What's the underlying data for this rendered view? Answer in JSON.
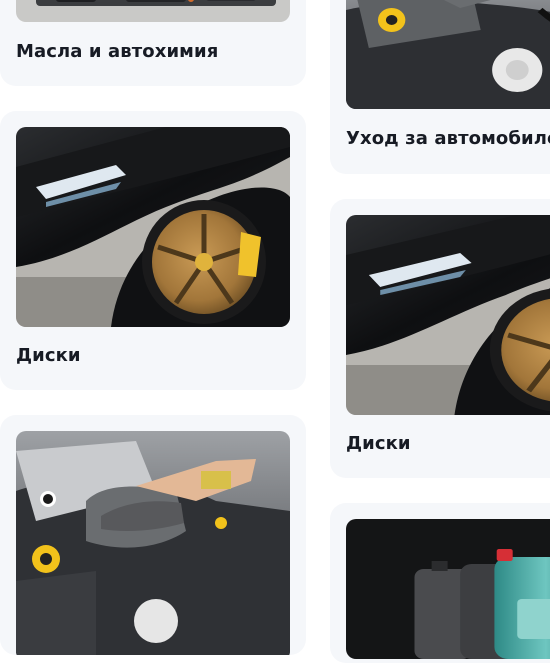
{
  "categories": [
    {
      "title": "Масла и автохимия",
      "image": "oils-chemicals-photo"
    },
    {
      "title": "Диски",
      "image": "golden-wheel-photo"
    },
    {
      "title": "",
      "image": "engine-wipe-photo"
    },
    {
      "title": "Уход за автомобилем",
      "image": "engine-wipe-photo"
    },
    {
      "title": "Диски",
      "image": "golden-wheel-photo"
    },
    {
      "title": "",
      "image": "oil-canisters-photo"
    }
  ]
}
